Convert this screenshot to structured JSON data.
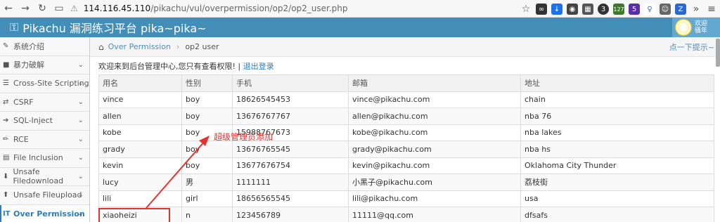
{
  "browser": {
    "url_host": "114.116.45.110",
    "url_path": "/pikachu/vul/overpermission/op2/op2_user.php",
    "ext_badges": [
      "127",
      "5"
    ]
  },
  "header": {
    "title": "Pikachu 漏洞练习平台 pika~pika~",
    "user_line1": "欢迎",
    "user_line2": "骚年"
  },
  "sidebar": {
    "items": [
      {
        "label": "系统介绍",
        "icon": "tag-icon"
      },
      {
        "label": "暴力破解",
        "icon": "box-icon"
      },
      {
        "label": "Cross-Site Scripting",
        "icon": "list-icon"
      },
      {
        "label": "CSRF",
        "icon": "share-icon"
      },
      {
        "label": "SQL-Inject",
        "icon": "arrow-icon"
      },
      {
        "label": "RCE",
        "icon": "pencil-icon"
      },
      {
        "label": "File Inclusion",
        "icon": "file-icon"
      },
      {
        "label": "Unsafe Filedownload",
        "icon": "download-icon"
      },
      {
        "label": "Unsafe Fileupload",
        "icon": "upload-icon"
      },
      {
        "label": "Over Permission",
        "icon": "text-icon"
      }
    ]
  },
  "breadcrumb": {
    "parent": "Over Permission",
    "current": "op2 user",
    "hint": "点一下提示~"
  },
  "content": {
    "welcome": "欢迎来到后台管理中心,您只有查看权限! |",
    "logout": "退出登录"
  },
  "table": {
    "headers": [
      "用名",
      "性别",
      "手机",
      "邮箱",
      "地址"
    ],
    "rows": [
      [
        "vince",
        "boy",
        "18626545453",
        "vince@pikachu.com",
        "chain"
      ],
      [
        "allen",
        "boy",
        "13676767767",
        "allen@pikachu.com",
        "nba 76"
      ],
      [
        "kobe",
        "boy",
        "15988767673",
        "kobe@pikachu.com",
        "nba lakes"
      ],
      [
        "grady",
        "boy",
        "13676765545",
        "grady@pikachu.com",
        "nba hs"
      ],
      [
        "kevin",
        "boy",
        "13677676754",
        "kevin@pikachu.com",
        "Oklahoma City Thunder"
      ],
      [
        "lucy",
        "男",
        "1111111",
        "小黑子@pikachu.com",
        "荔枝街"
      ],
      [
        "lili",
        "girl",
        "18656565545",
        "lili@pikachu.com",
        "usa"
      ],
      [
        "xiaoheizi",
        "n",
        "123456789",
        "11111@qq.com",
        "dfsafs"
      ]
    ]
  },
  "annotation": {
    "text": "超级管理员添加",
    "color": "#e8322f"
  }
}
